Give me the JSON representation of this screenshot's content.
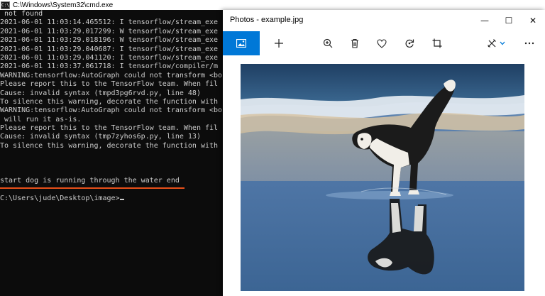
{
  "cmd": {
    "title": "C:\\Windows\\System32\\cmd.exe",
    "icon_text": "C:\\",
    "lines": [
      " not found",
      "2021-06-01 11:03:14.465512: I tensorflow/stream_exe",
      "2021-06-01 11:03:29.017299: W tensorflow/stream_exe",
      "2021-06-01 11:03:29.018196: W tensorflow/stream_exe",
      "2021-06-01 11:03:29.040687: I tensorflow/stream_exe",
      "2021-06-01 11:03:29.041120: I tensorflow/stream_exe",
      "2021-06-01 11:03:37.061718: I tensorflow/compiler/m",
      "WARNING:tensorflow:AutoGraph could not transform <bo",
      "Please report this to the TensorFlow team. When fil",
      "Cause: invalid syntax (tmpd3pg6rvd.py, line 48)",
      "To silence this warning, decorate the function with",
      "WARNING:tensorflow:AutoGraph could not transform <bo",
      " will run it as-is.",
      "Please report this to the TensorFlow team. When fil",
      "Cause: invalid syntax (tmp7zyhos6p.py, line 13)",
      "To silence this warning, decorate the function with",
      "",
      "",
      "",
      "start dog is running through the water end",
      "",
      "C:\\Users\\jude\\Desktop\\image>"
    ]
  },
  "photos": {
    "title": "Photos - example.jpg",
    "window_controls": {
      "minimize": "—",
      "maximize": "☐",
      "close": "✕"
    },
    "toolbar": [
      "picture-view",
      "add",
      "zoom",
      "delete",
      "favorite",
      "rotate",
      "crop",
      "edit",
      "more"
    ],
    "image_alt": "Dog running through the water on a beach with reflection"
  },
  "colors": {
    "console_bg": "#0c0c0c",
    "console_text": "#cccccc",
    "accent_blue": "#0078d7",
    "underline_orange": "#e8501a"
  }
}
